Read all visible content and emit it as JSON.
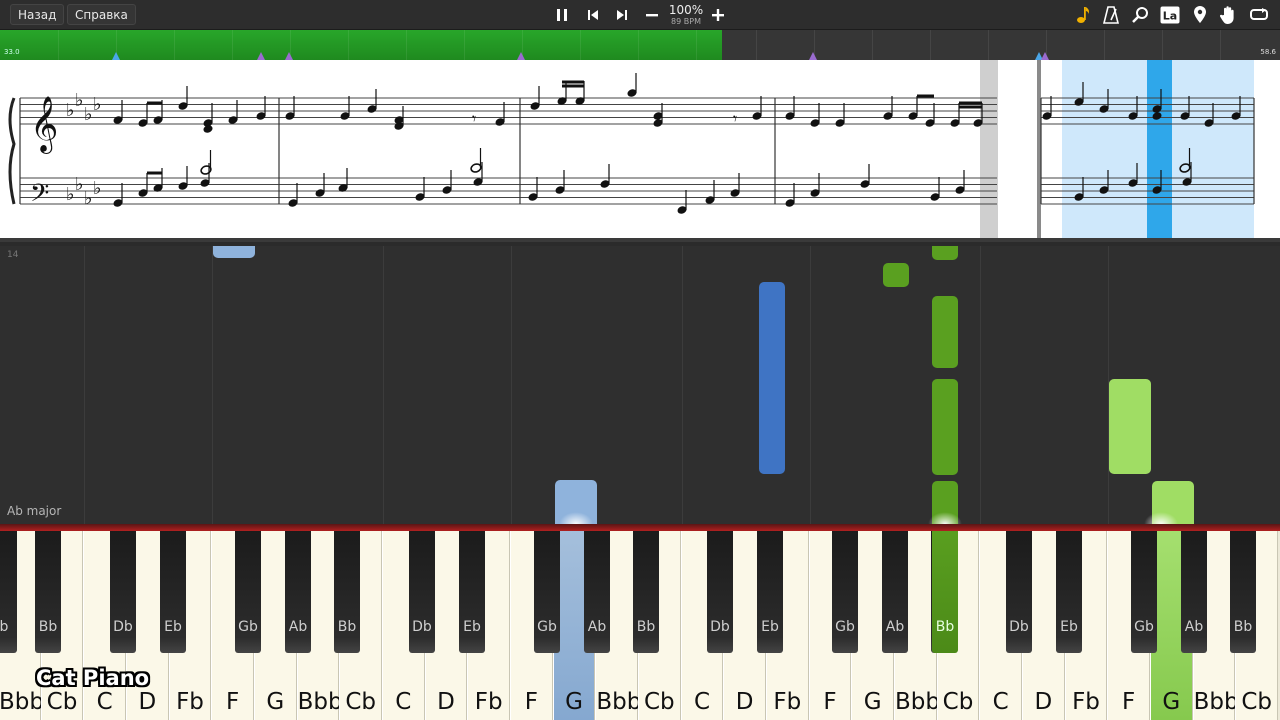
{
  "toolbar": {
    "back_label": "Назад",
    "help_label": "Справка",
    "zoom": "100%",
    "tempo": "89 BPM",
    "icons": [
      "pause-icon",
      "skip-back-icon",
      "skip-forward-icon",
      "minus-icon",
      "plus-icon",
      "note-icon",
      "metronome-icon",
      "magnifier-icon",
      "note-name-icon",
      "map-pin-icon",
      "hand-icon",
      "loop-icon"
    ]
  },
  "timeline": {
    "start_label": "33.0",
    "end_label": "58.6",
    "progress": 0.564
  },
  "piano_roll": {
    "bar_number": "14",
    "key_label": "Ab major",
    "colors": {
      "left_hand": "#3f74c4",
      "left_hand_light": "#8fb3dc",
      "right_hand": "#5aa020",
      "right_hand_light": "#a0dd64"
    }
  },
  "keyboard": {
    "white_keys": [
      "Bbb",
      "Cb",
      "C",
      "D",
      "Fb",
      "F",
      "G",
      "Bbb",
      "Cb",
      "C",
      "D",
      "Fb",
      "F",
      "G",
      "Bbb",
      "Cb",
      "C",
      "D",
      "Fb",
      "F",
      "G",
      "Bbb",
      "Cb",
      "C",
      "D",
      "Fb",
      "F",
      "G",
      "Bbb",
      "Cb"
    ],
    "black_keys": [
      "b",
      "Bb",
      "Db",
      "Eb",
      "Gb",
      "Ab",
      "Bb",
      "Db",
      "Eb",
      "Gb",
      "Ab",
      "Bb",
      "Db",
      "Eb",
      "Gb",
      "Ab",
      "Bb",
      "Db",
      "Eb",
      "Gb",
      "Ab",
      "Bb"
    ]
  },
  "watermark": "Cat Piano"
}
